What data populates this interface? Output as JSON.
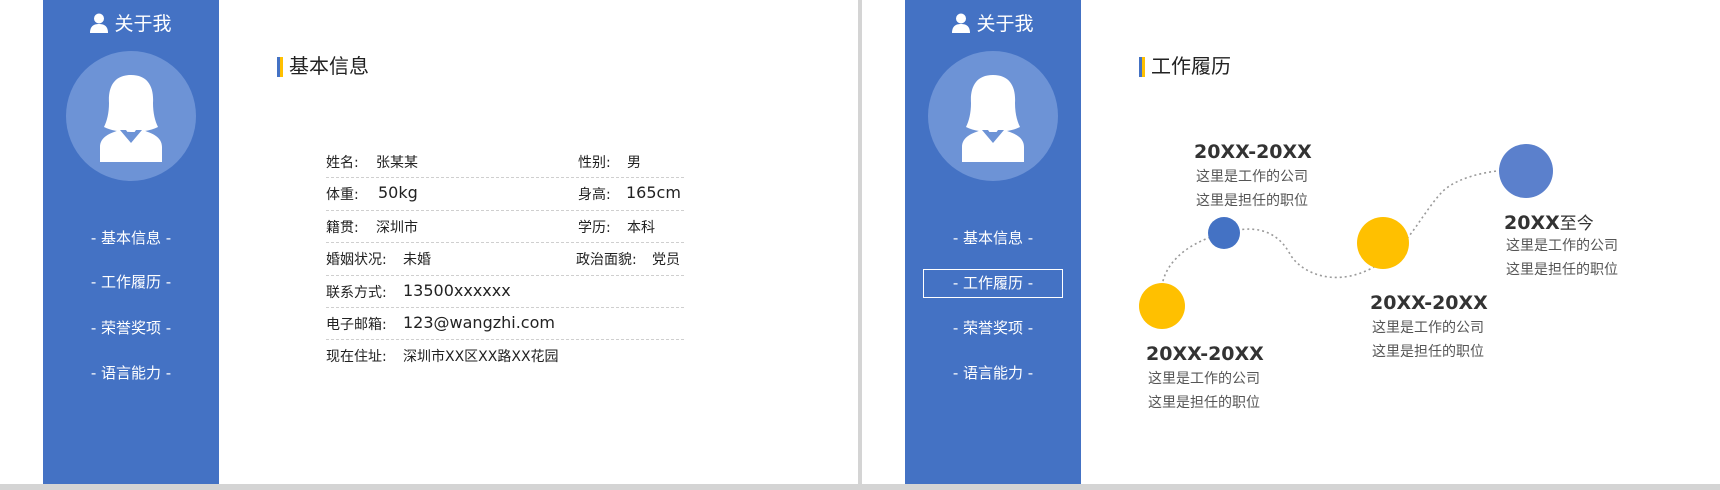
{
  "slide1": {
    "about_title": "关于我",
    "nav": [
      "- 基本信息 -",
      "- 工作履历 -",
      "- 荣誉奖项 -",
      "- 语言能力 -"
    ],
    "active_nav": 0,
    "section_title": "基本信息",
    "info": {
      "rows": [
        {
          "label": "姓名:",
          "value": "张某某",
          "label2": "性别:",
          "value2": "男"
        },
        {
          "label": "体重:",
          "value": "50kg",
          "label2": "身高:",
          "value2": "165cm"
        },
        {
          "label": "籍贯:",
          "value": "深圳市",
          "label2": "学历:",
          "value2": "本科"
        },
        {
          "label": "婚姻状况:",
          "value": "未婚",
          "label2": "政治面貌:",
          "value2": "党员"
        },
        {
          "label": "联系方式:",
          "value": "13500xxxxxx"
        },
        {
          "label": "电子邮箱:",
          "value": "123@wangzhi.com"
        },
        {
          "label": "现在住址:",
          "value": "深圳市XX区XX路XX花园"
        }
      ]
    }
  },
  "slide2": {
    "about_title": "关于我",
    "nav": [
      "- 基本信息 -",
      "- 工作履历 -",
      "- 荣誉奖项 -",
      "- 语言能力 -"
    ],
    "active_nav": 1,
    "section_title": "工作履历",
    "timeline": [
      {
        "date": "20XX-20XX",
        "company": "这里是工作的公司",
        "position": "这里是担任的职位"
      },
      {
        "date": "20XX-20XX",
        "company": "这里是工作的公司",
        "position": "这里是担任的职位"
      },
      {
        "date": "20XX-20XX",
        "company": "这里是工作的公司",
        "position": "这里是担任的职位"
      },
      {
        "date_bold": "20XX",
        "date_suffix": "至今",
        "company": "这里是工作的公司",
        "position": "这里是担任的职位"
      }
    ]
  },
  "colors": {
    "sidebar": "#4472c4",
    "avatar_bg": "#6d93d6",
    "accent_yellow": "#ffc000",
    "accent_blue": "#4472c4",
    "circle_light_blue": "#5b80cc",
    "page_gap": "#d4d4d4"
  },
  "icons": {
    "about": "person-icon",
    "avatar": "female-avatar-icon"
  }
}
